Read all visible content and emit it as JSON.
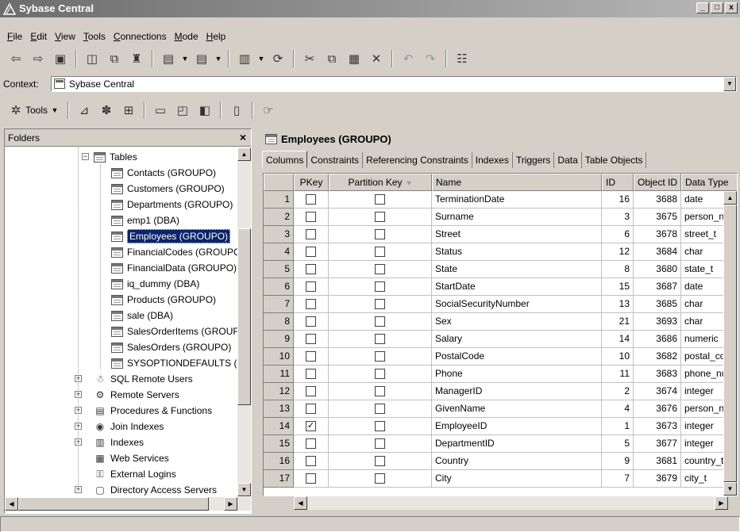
{
  "window": {
    "title": "Sybase Central",
    "min": "_",
    "max": "□",
    "close": "x"
  },
  "menu": [
    "File",
    "Edit",
    "View",
    "Tools",
    "Connections",
    "Mode",
    "Help"
  ],
  "context": {
    "label": "Context:",
    "value": "Sybase Central"
  },
  "toolbar2": {
    "tools_label": "Tools"
  },
  "folders": {
    "header": "Folders",
    "close": "×",
    "items": [
      {
        "label": "Tables",
        "type": "table",
        "level": 1,
        "expander": "−"
      },
      {
        "label": "Contacts (GROUPO)",
        "type": "table",
        "level": 2
      },
      {
        "label": "Customers (GROUPO)",
        "type": "table",
        "level": 2
      },
      {
        "label": "Departments (GROUPO)",
        "type": "table",
        "level": 2
      },
      {
        "label": "emp1 (DBA)",
        "type": "table",
        "level": 2
      },
      {
        "label": "Employees (GROUPO)",
        "type": "table",
        "level": 2,
        "selected": true
      },
      {
        "label": "FinancialCodes (GROUPC",
        "type": "table",
        "level": 2
      },
      {
        "label": "FinancialData (GROUPO)",
        "type": "table",
        "level": 2
      },
      {
        "label": "iq_dummy (DBA)",
        "type": "table",
        "level": 2
      },
      {
        "label": "Products (GROUPO)",
        "type": "table",
        "level": 2
      },
      {
        "label": "sale (DBA)",
        "type": "table",
        "level": 2
      },
      {
        "label": "SalesOrderItems (GROUF",
        "type": "table",
        "level": 2
      },
      {
        "label": "SalesOrders (GROUPO)",
        "type": "table",
        "level": 2
      },
      {
        "label": "SYSOPTIONDEFAULTS (D",
        "type": "table",
        "level": 2
      },
      {
        "label": "SQL Remote Users",
        "type": "folder",
        "icon": "users-icon",
        "level": 0,
        "expander": "+"
      },
      {
        "label": "Remote Servers",
        "type": "folder",
        "icon": "server-icon",
        "level": 0,
        "expander": "+"
      },
      {
        "label": "Procedures & Functions",
        "type": "folder",
        "icon": "procedure-icon",
        "level": 0,
        "expander": "+"
      },
      {
        "label": "Join Indexes",
        "type": "folder",
        "icon": "join-index-icon",
        "level": 0,
        "expander": "+"
      },
      {
        "label": "Indexes",
        "type": "folder",
        "icon": "index-icon",
        "level": 0,
        "expander": "+"
      },
      {
        "label": "Web Services",
        "type": "folder",
        "icon": "web-services-icon",
        "level": 0
      },
      {
        "label": "External Logins",
        "type": "folder",
        "icon": "login-icon",
        "level": 0
      },
      {
        "label": "Directory Access Servers",
        "type": "folder",
        "icon": "directory-icon",
        "level": 0,
        "expander": "+"
      }
    ]
  },
  "details": {
    "title": "Employees (GROUPO)",
    "tabs": [
      "Columns",
      "Constraints",
      "Referencing Constraints",
      "Indexes",
      "Triggers",
      "Data",
      "Table Objects"
    ],
    "active_tab": 0,
    "columns": [
      "PKey",
      "Partition Key",
      "Name",
      "ID",
      "Object ID",
      "Data Type"
    ],
    "sort_indicator": "▼",
    "rows": [
      {
        "n": "1",
        "pkey": false,
        "pk": false,
        "name": "TerminationDate",
        "id": "16",
        "oid": "3688",
        "type": "date"
      },
      {
        "n": "2",
        "pkey": false,
        "pk": false,
        "name": "Surname",
        "id": "3",
        "oid": "3675",
        "type": "person_na"
      },
      {
        "n": "3",
        "pkey": false,
        "pk": false,
        "name": "Street",
        "id": "6",
        "oid": "3678",
        "type": "street_t"
      },
      {
        "n": "4",
        "pkey": false,
        "pk": false,
        "name": "Status",
        "id": "12",
        "oid": "3684",
        "type": "char"
      },
      {
        "n": "5",
        "pkey": false,
        "pk": false,
        "name": "State",
        "id": "8",
        "oid": "3680",
        "type": "state_t"
      },
      {
        "n": "6",
        "pkey": false,
        "pk": false,
        "name": "StartDate",
        "id": "15",
        "oid": "3687",
        "type": "date"
      },
      {
        "n": "7",
        "pkey": false,
        "pk": false,
        "name": "SocialSecurityNumber",
        "id": "13",
        "oid": "3685",
        "type": "char"
      },
      {
        "n": "8",
        "pkey": false,
        "pk": false,
        "name": "Sex",
        "id": "21",
        "oid": "3693",
        "type": "char"
      },
      {
        "n": "9",
        "pkey": false,
        "pk": false,
        "name": "Salary",
        "id": "14",
        "oid": "3686",
        "type": "numeric"
      },
      {
        "n": "10",
        "pkey": false,
        "pk": false,
        "name": "PostalCode",
        "id": "10",
        "oid": "3682",
        "type": "postal_co"
      },
      {
        "n": "11",
        "pkey": false,
        "pk": false,
        "name": "Phone",
        "id": "11",
        "oid": "3683",
        "type": "phone_nu"
      },
      {
        "n": "12",
        "pkey": false,
        "pk": false,
        "name": "ManagerID",
        "id": "2",
        "oid": "3674",
        "type": "integer"
      },
      {
        "n": "13",
        "pkey": false,
        "pk": false,
        "name": "GivenName",
        "id": "4",
        "oid": "3676",
        "type": "person_na"
      },
      {
        "n": "14",
        "pkey": true,
        "pk": false,
        "name": "EmployeeID",
        "id": "1",
        "oid": "3673",
        "type": "integer"
      },
      {
        "n": "15",
        "pkey": false,
        "pk": false,
        "name": "DepartmentID",
        "id": "5",
        "oid": "3677",
        "type": "integer"
      },
      {
        "n": "16",
        "pkey": false,
        "pk": false,
        "name": "Country",
        "id": "9",
        "oid": "3681",
        "type": "country_t"
      },
      {
        "n": "17",
        "pkey": false,
        "pk": false,
        "name": "City",
        "id": "7",
        "oid": "3679",
        "type": "city_t"
      }
    ]
  },
  "colors": {
    "selection": "#0a246a",
    "face": "#d4d0c8"
  }
}
